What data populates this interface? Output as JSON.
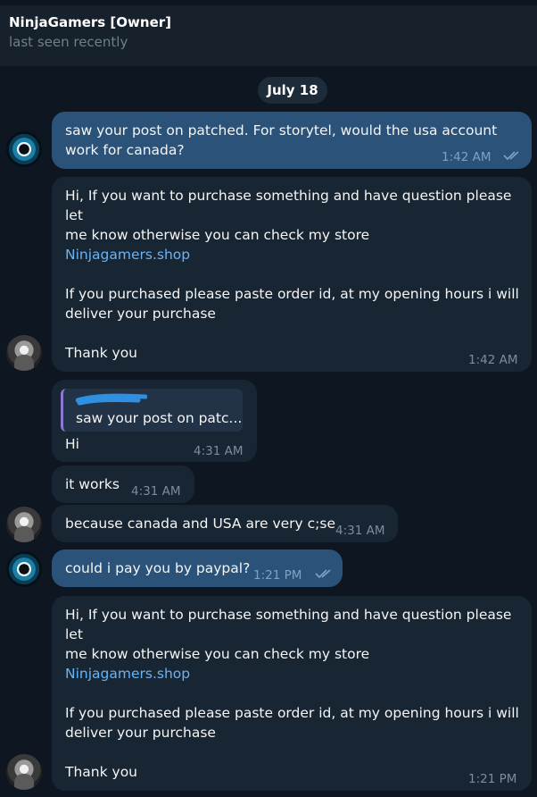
{
  "header": {
    "name": "NinjaGamers [Owner]",
    "status": "last seen recently"
  },
  "date_separator": "July 18",
  "messages": [
    {
      "text": "saw your post on patched. For storytel, would the usa account\nwork for canada?",
      "time": "1:42 AM"
    },
    {
      "line1": "Hi, If you want to purchase something and have question please let\nme know otherwise you can check my store",
      "link": "Ninjagamers.shop",
      "line3": "If you purchased please paste order id, at my opening hours i will\ndeliver your purchase",
      "line4": "Thank you",
      "time": "1:42 AM"
    },
    {
      "reply_to": "saw your post on patc...",
      "text": "Hi",
      "time": "4:31 AM"
    },
    {
      "text": "it works",
      "time": "4:31 AM"
    },
    {
      "text": "because canada and USA are very c;se",
      "time": "4:31 AM"
    },
    {
      "text": "could i pay you by paypal?",
      "time": "1:21 PM"
    },
    {
      "line1": "Hi, If you want to purchase something and have question please let\nme know otherwise you can check my store",
      "link": "Ninjagamers.shop",
      "line3": "If you purchased please paste order id, at my opening hours i will\ndeliver your purchase",
      "line4": "Thank you",
      "time": "1:21 PM"
    }
  ],
  "colors": {
    "outgoing": "#2b5278",
    "incoming": "#182533",
    "link": "#6ab3f3",
    "background": "#0e1621"
  }
}
